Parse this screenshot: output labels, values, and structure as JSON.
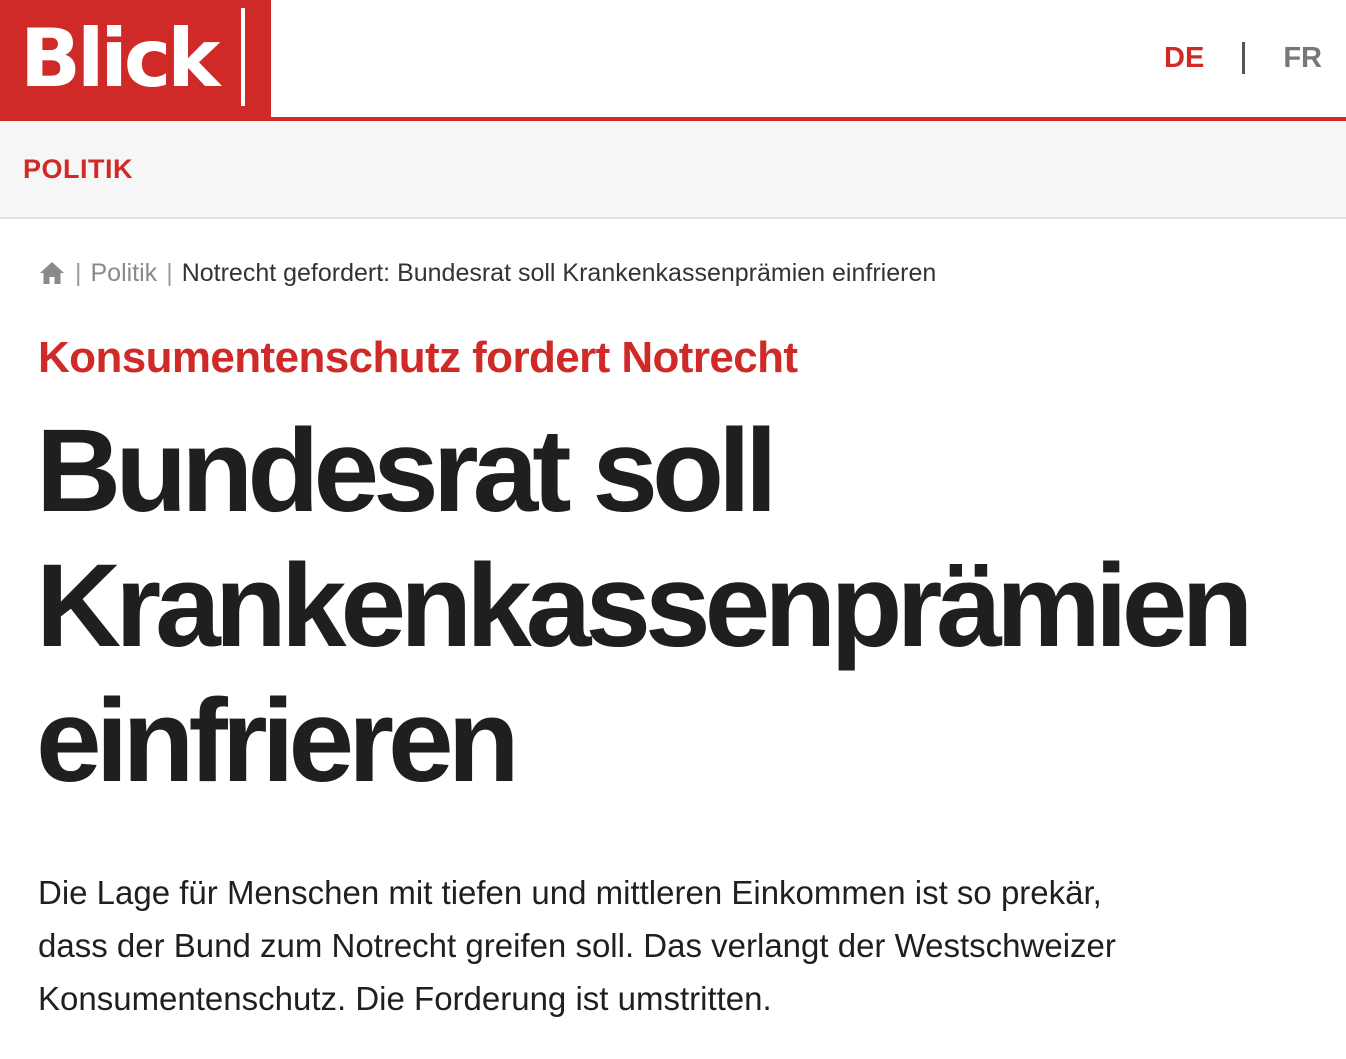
{
  "header": {
    "logo_text": "Blick",
    "languages": {
      "de": "DE",
      "fr": "FR",
      "active": "DE"
    }
  },
  "section": {
    "label": "POLITIK"
  },
  "breadcrumb": {
    "home_icon": "home-icon",
    "items": [
      {
        "label": "Politik"
      },
      {
        "label": "Notrecht gefordert: Bundesrat soll Krankenkassenprämien einfrieren"
      }
    ]
  },
  "article": {
    "kicker": "Konsumentenschutz fordert Notrecht",
    "title_line_1": "Bundesrat soll",
    "title_line_2": "Krankenkassenprämien",
    "title_line_3": "einfrieren",
    "lead_line_1": "Die Lage für Menschen mit tiefen und mittleren Einkommen ist so prekär,",
    "lead_line_2": "dass der Bund zum Notrecht greifen soll. Das verlangt der Westschweizer",
    "lead_line_3": "Konsumentenschutz. Die Forderung ist umstritten."
  },
  "colors": {
    "brand_red": "#cf2a27",
    "text_dark": "#1f1f1f",
    "section_bg": "#f6f6f6"
  }
}
